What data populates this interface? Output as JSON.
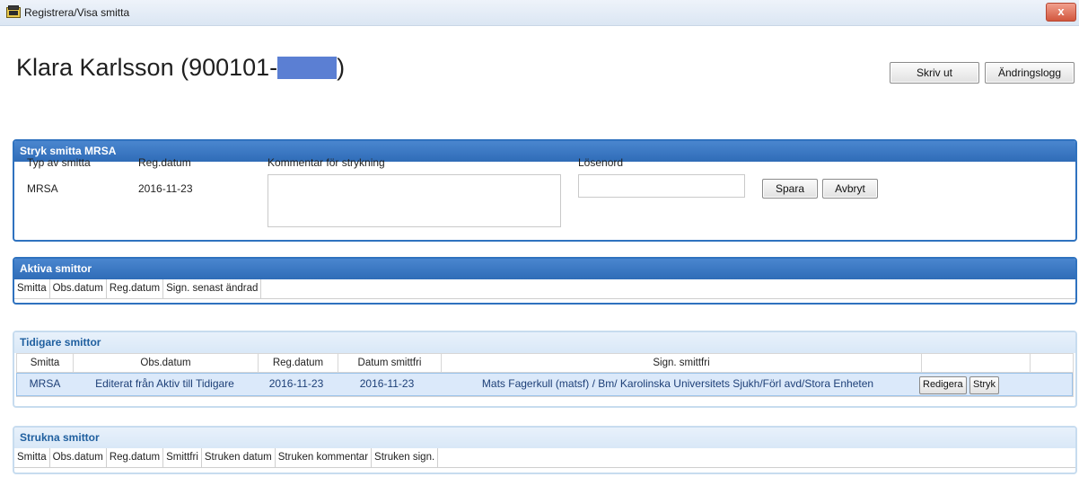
{
  "window": {
    "title": "Registrera/Visa smitta",
    "close_label": "x"
  },
  "patient": {
    "name": "Klara Karlsson (900101-",
    "suffix": ")"
  },
  "toolbar": {
    "print_label": "Skriv ut",
    "log_label": "Ändringslogg"
  },
  "stryk": {
    "heading": "Stryk smitta MRSA",
    "type_label": "Typ av smitta",
    "type_value": "MRSA",
    "regdate_label": "Reg.datum",
    "regdate_value": "2016-11-23",
    "comment_label": "Kommentar för strykning",
    "comment_value": "",
    "password_label": "Lösenord",
    "password_value": "",
    "save_label": "Spara",
    "cancel_label": "Avbryt"
  },
  "active": {
    "heading": "Aktiva smittor",
    "columns": [
      "Smitta",
      "Obs.datum",
      "Reg.datum",
      "Sign. senast ändrad"
    ]
  },
  "previous": {
    "heading": "Tidigare smittor",
    "columns": [
      "Smitta",
      "Obs.datum",
      "Reg.datum",
      "Datum smittfri",
      "Sign. smittfri",
      "",
      ""
    ],
    "rows": [
      {
        "smitta": "MRSA",
        "obs": "Editerat från Aktiv till Tidigare",
        "reg": "2016-11-23",
        "smittfri_date": "2016-11-23",
        "sign": "Mats Fagerkull (matsf) / Bm/ Karolinska Universitets Sjukh/Förl avd/Stora Enheten",
        "edit_label": "Redigera",
        "strike_label": "Stryk"
      }
    ]
  },
  "struck": {
    "heading": "Strukna smittor",
    "columns": [
      "Smitta",
      "Obs.datum",
      "Reg.datum",
      "Smittfri",
      "Struken datum",
      "Struken kommentar",
      "Struken sign."
    ]
  }
}
